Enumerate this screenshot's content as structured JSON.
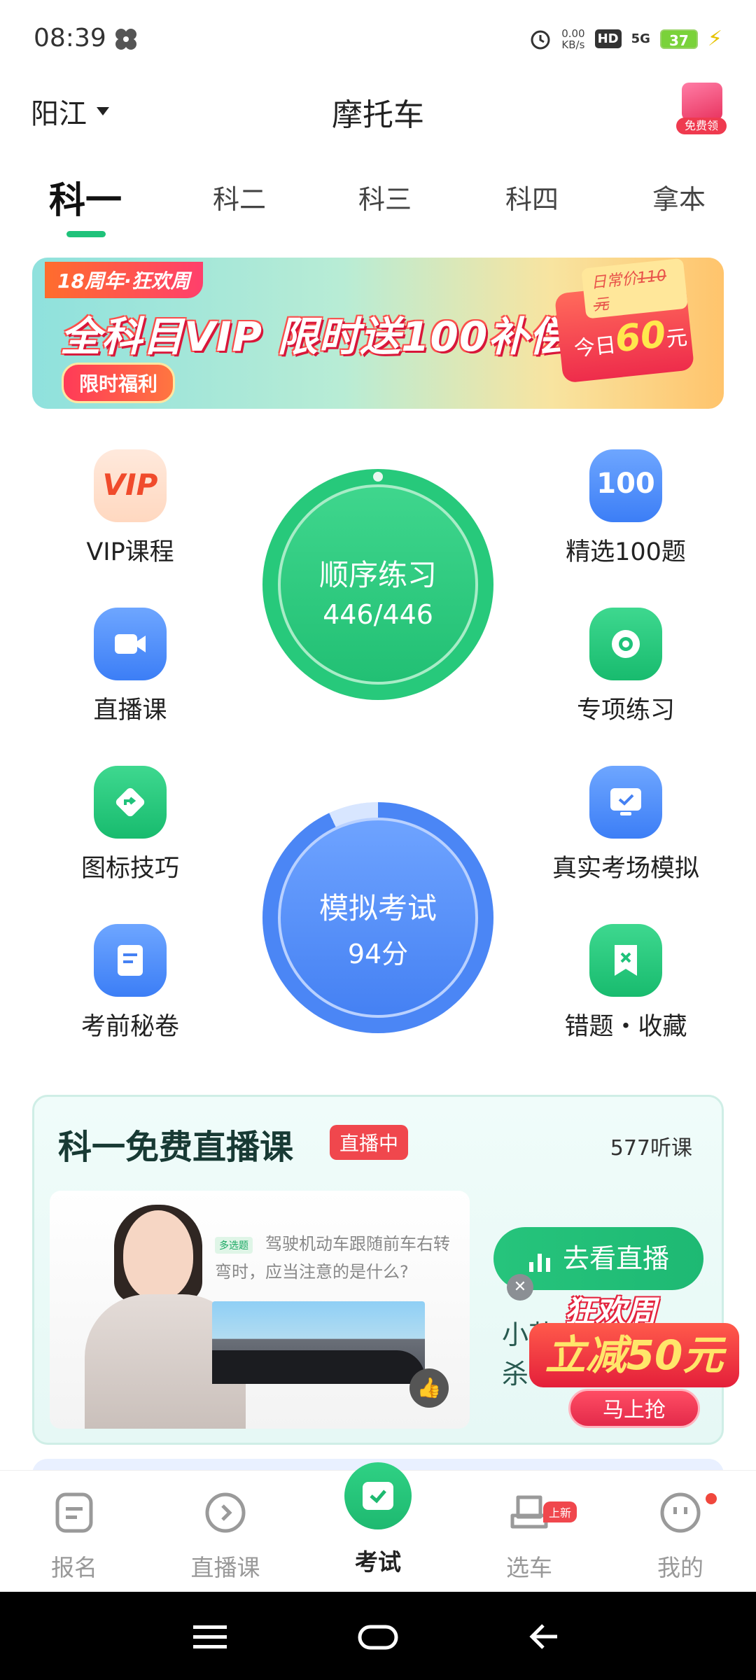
{
  "status_bar": {
    "time": "08:39",
    "speed_value": "0.00",
    "speed_unit": "KB/s",
    "hd": "HD",
    "network": "5G",
    "battery": "37"
  },
  "header": {
    "city": "阳江",
    "title": "摩托车",
    "gift_label": "免费领"
  },
  "tabs": [
    "科一",
    "科二",
    "科三",
    "科四",
    "拿本"
  ],
  "banner": {
    "anniversary": "18周年·狂欢周",
    "headline": "全科目VIP 限时送100补偿金",
    "limited": "限时福利",
    "old_price_label": "日常价",
    "old_price": "110元",
    "today_label": "今日",
    "today_price": "60",
    "today_unit": "元"
  },
  "features": {
    "vip_icon_text": "VIP",
    "vip": "VIP课程",
    "hundred_icon_text": "100",
    "hundred": "精选100题",
    "live": "直播课",
    "special": "专项练习",
    "signs": "图标技巧",
    "real_exam": "真实考场模拟",
    "secret": "考前秘卷",
    "mistakes": "错题・收藏"
  },
  "practice": {
    "label": "顺序练习",
    "progress": "446/446"
  },
  "mock_exam": {
    "label": "模拟考试",
    "score": "94分"
  },
  "live_card": {
    "title": "科一免费直播课",
    "badge": "直播中",
    "listeners": "577听课",
    "question_tag": "多选题",
    "question": "驾驶机动车跟随前车右转弯时，应当注意的是什么?",
    "go_button": "去看直播",
    "teacher_line1": "小花摩",
    "teacher_line2": "杀"
  },
  "promo": {
    "carnival": "狂欢周",
    "reduce": "立减50元",
    "grab": "马上抢"
  },
  "bottom_nav": {
    "items": [
      {
        "label": "报名"
      },
      {
        "label": "直播课"
      },
      {
        "label": "考试"
      },
      {
        "label": "选车",
        "tag": "上新"
      },
      {
        "label": "我的"
      }
    ]
  },
  "colors": {
    "accent_green": "#1fc27a",
    "accent_blue": "#4581f3",
    "live_red": "#f0474d"
  }
}
